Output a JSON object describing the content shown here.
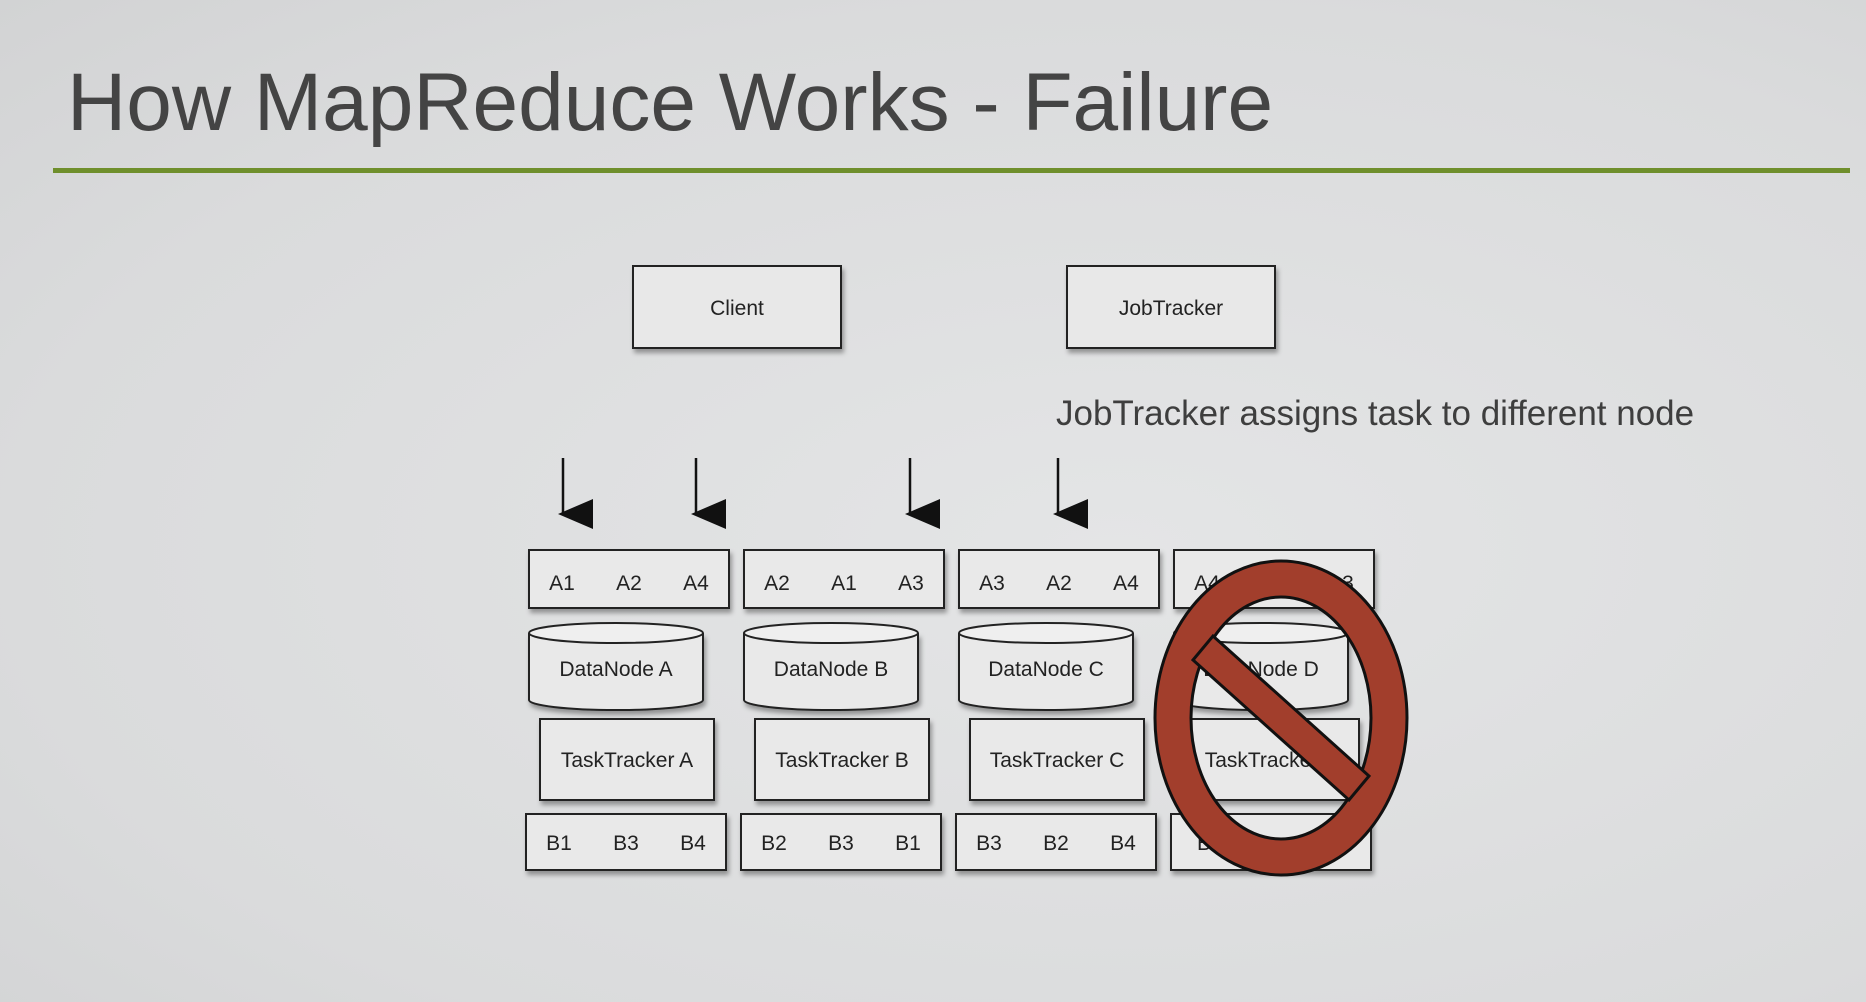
{
  "title": "How MapReduce Works - Failure",
  "note": "JobTracker assigns task to different node",
  "client_label": "Client",
  "jobtracker_label": "JobTracker",
  "nodes": [
    {
      "top_blocks": [
        "A1",
        "A2",
        "A4"
      ],
      "datanode": "DataNode A",
      "tasktracker": "TaskTracker A",
      "bottom_blocks": [
        "B1",
        "B3",
        "B4"
      ],
      "failed": false
    },
    {
      "top_blocks": [
        "A2",
        "A1",
        "A3"
      ],
      "datanode": "DataNode B",
      "tasktracker": "TaskTracker B",
      "bottom_blocks": [
        "B2",
        "B3",
        "B1"
      ],
      "failed": false
    },
    {
      "top_blocks": [
        "A3",
        "A2",
        "A4"
      ],
      "datanode": "DataNode C",
      "tasktracker": "TaskTracker C",
      "bottom_blocks": [
        "B3",
        "B2",
        "B4"
      ],
      "failed": false
    },
    {
      "top_blocks": [
        "A4",
        "",
        "A3"
      ],
      "datanode": "DataNode D",
      "tasktracker": "TaskTracker D",
      "bottom_blocks": [
        "B",
        "",
        ""
      ],
      "failed": true
    }
  ],
  "colors": {
    "accent_rule": "#6f8f2c",
    "failure_symbol": "#a23e2c"
  },
  "icons": [
    "down-arrow-icon",
    "prohibited-icon"
  ]
}
